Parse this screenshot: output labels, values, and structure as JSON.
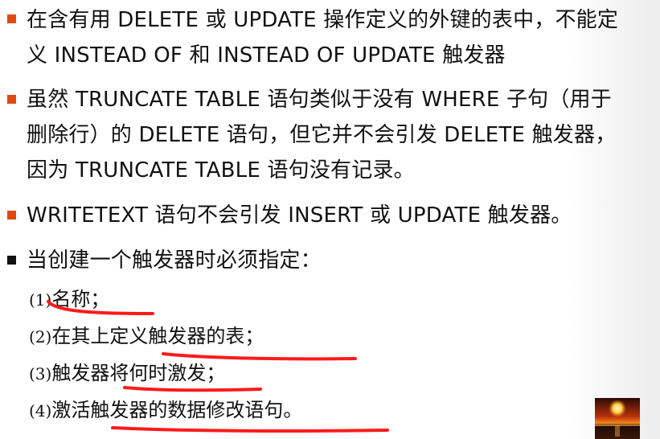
{
  "slide": {
    "bullets": [
      {
        "text": "在含有用 DELETE 或 UPDATE 操作定义的外键的表中，不能定义 INSTEAD OF 和 INSTEAD OF UPDATE 触发器",
        "marker_color": "#e04a12"
      },
      {
        "text": "虽然 TRUNCATE TABLE 语句类似于没有 WHERE 子句（用于删除行）的 DELETE 语句，但它并不会引发 DELETE 触发器，因为 TRUNCATE TABLE 语句没有记录。",
        "marker_color": "#e04a12"
      },
      {
        "text": "WRITETEXT 语句不会引发 INSERT 或 UPDATE 触发器。",
        "marker_color": "#e04a12"
      },
      {
        "text": "当创建一个触发器时必须指定：",
        "marker_color": "#111111"
      }
    ],
    "sub_items": [
      {
        "num": "(1)",
        "text": "名称；"
      },
      {
        "num": "(2)",
        "text": "在其上定义触发器的表；"
      },
      {
        "num": "(3)",
        "text": "触发器将何时激发；"
      },
      {
        "num": "(4)",
        "text": "激活触发器的数据修改语句。"
      }
    ],
    "annotation_color": "#ff1a1a",
    "thumbnail_icon": "sunset-image-icon"
  }
}
